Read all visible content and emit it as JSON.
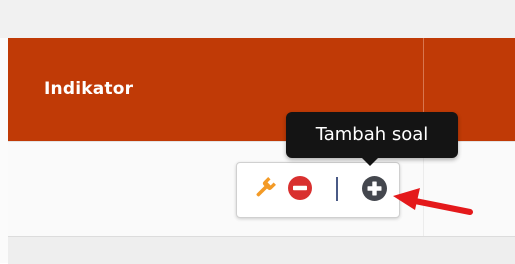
{
  "table": {
    "header_label": "Indikator"
  },
  "actions": {
    "edit_icon": "wrench-icon",
    "remove_icon": "minus-circle-icon",
    "separator": "|",
    "add_icon": "plus-circle-icon"
  },
  "tooltip": {
    "text": "Tambah soal"
  },
  "annotation": {
    "arrow_icon": "red-arrow-icon"
  },
  "colors": {
    "header_bg": "#c03a06",
    "wrench": "#f39a26",
    "remove": "#d9302f",
    "add": "#44474e",
    "tooltip_bg": "#141414",
    "arrow": "#e4191b"
  }
}
